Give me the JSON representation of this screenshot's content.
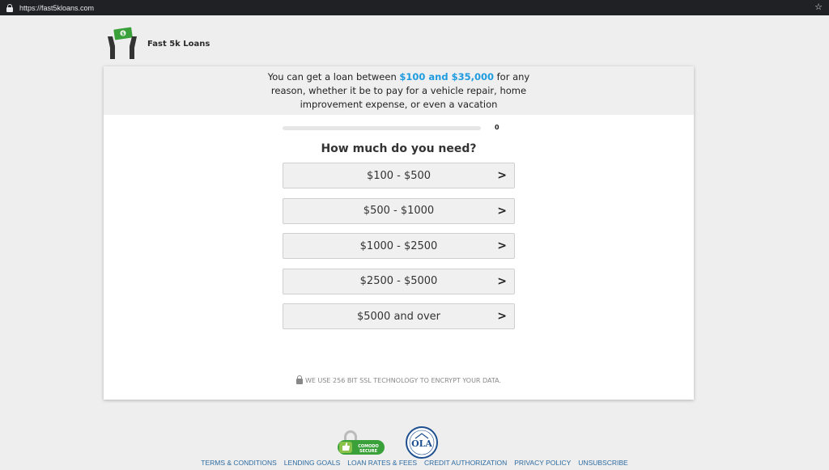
{
  "browser": {
    "url": "https://fast5kloans.com"
  },
  "brand": {
    "name": "Fast 5k Loans"
  },
  "intro": {
    "before": "You can get a loan between ",
    "highlight": "$100 and $35,000",
    "after": " for any reason, whether it be to pay for a vehicle repair, home improvement expense, or even a vacation"
  },
  "progress": {
    "value": 0,
    "label": "0"
  },
  "question": "How much do you need?",
  "options": [
    {
      "label": "$100 - $500"
    },
    {
      "label": "$500 - $1000"
    },
    {
      "label": "$1000 - $2500"
    },
    {
      "label": "$2500 - $5000"
    },
    {
      "label": "$5000 and over"
    }
  ],
  "ssl_note": "WE USE 256 BIT SSL TECHNOLOGY TO ENCRYPT YOUR DATA.",
  "badges": {
    "comodo_text": "COMODO SECURE",
    "ola_text": "OLA"
  },
  "footer": {
    "links": [
      "TERMS & CONDITIONS",
      "LENDING GOALS",
      "LOAN RATES & FEES",
      "CREDIT AUTHORIZATION",
      "PRIVACY POLICY",
      "UNSUBSCRIBE"
    ]
  },
  "colors": {
    "accent": "#1f9be0",
    "link": "#2c6aa0",
    "money": "#3aa13a"
  }
}
